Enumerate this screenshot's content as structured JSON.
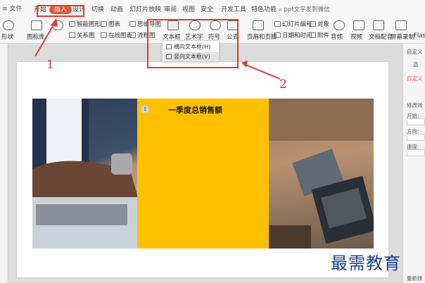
{
  "tabs": [
    {
      "label": "开始"
    },
    {
      "label": "插入"
    },
    {
      "label": "设计"
    },
    {
      "label": "切换"
    },
    {
      "label": "动画"
    },
    {
      "label": "幻灯片放映"
    },
    {
      "label": "审阅"
    },
    {
      "label": "视图"
    },
    {
      "label": "安全"
    },
    {
      "label": "开发工具"
    },
    {
      "label": "特色功能"
    }
  ],
  "search": {
    "placeholder": "ppt文字发到微信"
  },
  "ribbon": {
    "shapes": "形状",
    "gallery": "图标库",
    "smartart": "智能图形",
    "chart": "图表",
    "relation": "关系图",
    "online_chart": "在线图表",
    "mindmap": "思维导图",
    "flowchart": "流程图",
    "textbox": "文本框",
    "wordart": "艺术字",
    "symbol": "符号",
    "formula": "公式",
    "header_footer": "页眉和页脚",
    "slide_number": "幻灯片编号",
    "object": "对象",
    "datetime": "日期和时间",
    "attachment": "附件",
    "audio": "音频",
    "video": "视频",
    "text_audio": "文档配音",
    "screen_record": "屏幕录制",
    "flash": "Flas"
  },
  "textbox_menu": [
    {
      "label": "横向文本框(H)"
    },
    {
      "label": "竖向文本框(V)"
    }
  ],
  "annotations": {
    "one": "1",
    "two": "2"
  },
  "slide": {
    "number": "1",
    "title": "一季度总销售额"
  },
  "right_pane": {
    "title": "自定义",
    "select": "选",
    "custom": "自定义",
    "modify": "修改效",
    "start": "开始:",
    "direction": "方向:",
    "speed": "速度:",
    "reorder": "重新排"
  },
  "watermark": "最需教育",
  "colors": {
    "active_tab": "#e2583a",
    "annotation_red": "#e53935",
    "slide_yellow": "#ffc000",
    "watermark_blue": "#1a3d8f"
  }
}
